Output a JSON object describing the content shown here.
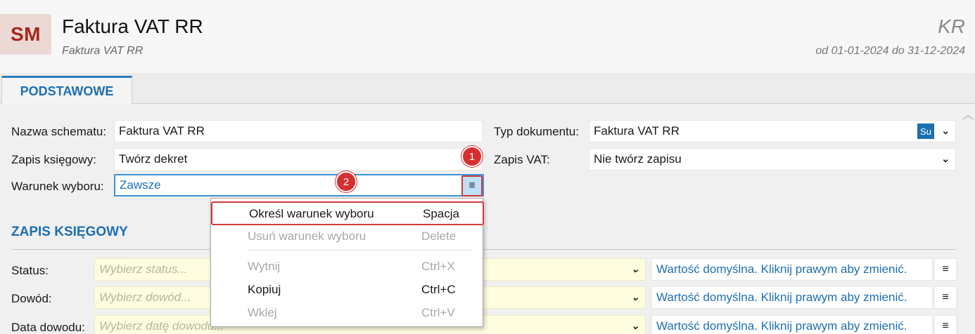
{
  "header": {
    "avatar": "SM",
    "title": "Faktura VAT RR",
    "subtitle": "Faktura VAT RR",
    "code": "KR",
    "period": "od 01-01-2024 do 31-12-2024"
  },
  "tabs": [
    {
      "label": "PODSTAWOWE",
      "active": true
    }
  ],
  "form": {
    "schema_name_label": "Nazwa schematu:",
    "schema_name_value": "Faktura VAT RR",
    "entry_label": "Zapis księgowy:",
    "entry_value": "Twórz dekret",
    "condition_label": "Warunek wyboru:",
    "condition_value": "Zawsze",
    "condition_menu_icon": "≡",
    "doc_type_label": "Typ dokumentu:",
    "doc_type_value": "Faktura VAT RR",
    "doc_type_badge": "Su",
    "vat_label": "Zapis VAT:",
    "vat_value": "Nie twórz zapisu"
  },
  "badges": {
    "one": "1",
    "two": "2",
    "color": "#d62f2f"
  },
  "section": {
    "title": "ZAPIS KSIĘGOWY",
    "rows": [
      {
        "label": "Status:",
        "placeholder": "Wybierz status...",
        "default_text": "Wartość domyślna. Kliknij prawym aby zmienić."
      },
      {
        "label": "Dowód:",
        "placeholder": "Wybierz dowód...",
        "default_text": "Wartość domyślna. Kliknij prawym aby zmienić."
      },
      {
        "label": "Data dowodu:",
        "placeholder": "Wybierz datę dowodu...",
        "default_text": "Wartość domyślna. Kliknij prawym aby zmienić."
      }
    ]
  },
  "context_menu": {
    "items": [
      {
        "label": "Określ warunek wyboru",
        "shortcut": "Spacja",
        "enabled": true,
        "highlighted": true
      },
      {
        "label": "Usuń warunek wyboru",
        "shortcut": "Delete",
        "enabled": false
      },
      {
        "label": "Wytnij",
        "shortcut": "Ctrl+X",
        "enabled": false
      },
      {
        "label": "Kopiuj",
        "shortcut": "Ctrl+C",
        "enabled": true
      },
      {
        "label": "Wklej",
        "shortcut": "Ctrl+V",
        "enabled": false
      }
    ]
  },
  "icons": {
    "chevron": "chevron-down-icon",
    "menu": "hamburger-menu-icon",
    "scroll": "scroll-up-icon"
  },
  "colors": {
    "accent": "#1c6fb2",
    "brand_avatar_bg": "#ecd9d6",
    "brand_avatar_fg": "#a6271c",
    "highlight_red": "#d23a3a",
    "required_yellow": "#fffde0"
  }
}
